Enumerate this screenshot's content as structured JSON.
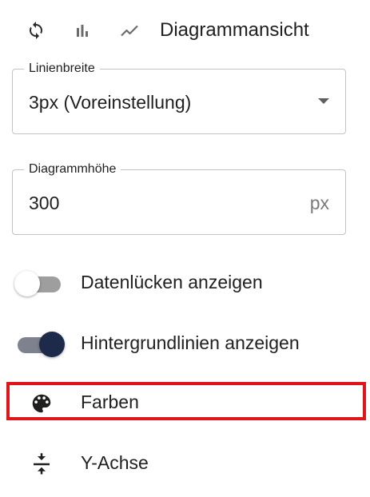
{
  "header": {
    "title": "Diagrammansicht",
    "icons": [
      "refresh-icon",
      "bar-chart-icon",
      "line-chart-icon"
    ]
  },
  "line_width": {
    "label": "Linienbreite",
    "value": "3px (Voreinstellung)"
  },
  "chart_height": {
    "label": "Diagrammhöhe",
    "value": "300",
    "unit": "px"
  },
  "settings": {
    "show_gaps": {
      "label": "Datenlücken anzeigen",
      "enabled": false
    },
    "show_grid": {
      "label": "Hintergrundlinien anzeigen",
      "enabled": true
    },
    "colors": {
      "label": "Farben",
      "icon": "palette-icon"
    },
    "y_axis": {
      "label": "Y-Achse",
      "icon": "compress-vertical-icon"
    }
  },
  "colors": {
    "accent": "#1e2a4a",
    "highlight": "#e0151b",
    "track_off": "#9e9e9e",
    "track_on": "#7d828e"
  }
}
